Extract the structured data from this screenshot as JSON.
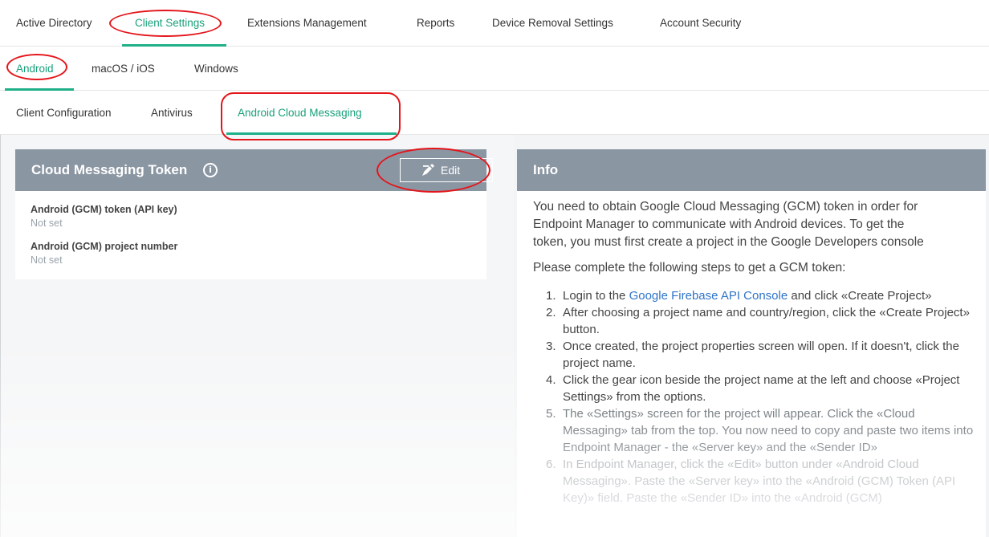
{
  "top_tabs": [
    "Active Directory",
    "Client Settings",
    "Extensions Management",
    "Reports",
    "Device Removal Settings",
    "Account Security"
  ],
  "os_tabs": [
    "Android",
    "macOS / iOS",
    "Windows"
  ],
  "sub_tabs": [
    "Client Configuration",
    "Antivirus",
    "Android Cloud Messaging"
  ],
  "token_panel": {
    "title": "Cloud Messaging Token",
    "info_glyph": "i",
    "edit_label": "Edit",
    "fields": [
      {
        "label": "Android (GCM) token (API key)",
        "value": "Not set"
      },
      {
        "label": "Android (GCM) project number",
        "value": "Not set"
      }
    ]
  },
  "info_panel": {
    "title": "Info",
    "intro_lines": [
      "You need to obtain Google Cloud Messaging (GCM) token in order for",
      "Endpoint Manager to communicate with Android devices. To get the",
      "token, you must first create a project in the Google Developers console"
    ],
    "steps_heading": "Please complete the following steps to get a GCM token:",
    "step1_prefix": "Login to the ",
    "step1_link": "Google Firebase API Console",
    "step1_suffix": " and click «Create Project»",
    "steps": [
      "After choosing a project name and country/region, click the «Create Project» button.",
      "Once created, the project properties screen will open. If it doesn't, click the project name.",
      "Click the gear icon beside the project name at the left and choose «Project Settings» from the options.",
      "The «Settings» screen for the project will appear. Click the «Cloud Messaging» tab from the top. You now need to copy and paste two items into Endpoint Manager - the «Server key» and the «Sender ID»",
      "In Endpoint Manager, click the «Edit» button under «Android Cloud Messaging». Paste the «Server key» into the «Android (GCM) Token (API Key)» field. Paste the «Sender ID» into the «Android (GCM)"
    ]
  },
  "colors": {
    "accent": "#20b089",
    "panel_header": "#8b96a3",
    "annotation": "#e4151b",
    "link": "#2f74c9"
  }
}
